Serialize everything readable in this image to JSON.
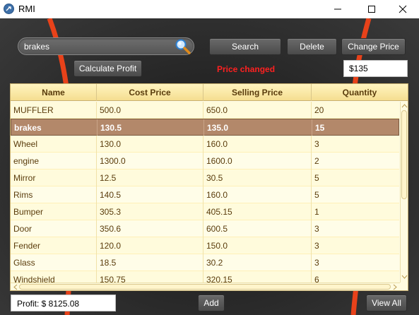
{
  "window": {
    "title": "RMI",
    "icon": "app-logo-icon",
    "controls": [
      "minimize-icon",
      "maximize-icon",
      "close-icon"
    ]
  },
  "search": {
    "value": "brakes",
    "icon": "magnifier-icon"
  },
  "toolbar": {
    "search_label": "Search",
    "delete_label": "Delete",
    "change_price_label": "Change Price",
    "calculate_profit_label": "Calculate Profit"
  },
  "status": {
    "message": "Price changed",
    "color": "#ff2020"
  },
  "price_input": {
    "value": "$135"
  },
  "table": {
    "columns": [
      "Name",
      "Cost Price",
      "Selling Price",
      "Quantity"
    ],
    "rows": [
      {
        "name": "MUFFLER",
        "cost": "500.0",
        "selling": "650.0",
        "quantity": "20"
      },
      {
        "name": "brakes",
        "cost": "130.5",
        "selling": "135.0",
        "quantity": "15"
      },
      {
        "name": "Wheel",
        "cost": "130.0",
        "selling": "160.0",
        "quantity": "3"
      },
      {
        "name": "engine",
        "cost": "1300.0",
        "selling": "1600.0",
        "quantity": "2"
      },
      {
        "name": "Mirror",
        "cost": "12.5",
        "selling": "30.5",
        "quantity": "5"
      },
      {
        "name": "Rims",
        "cost": "140.5",
        "selling": "160.0",
        "quantity": "5"
      },
      {
        "name": "Bumper",
        "cost": "305.3",
        "selling": "405.15",
        "quantity": "1"
      },
      {
        "name": "Door",
        "cost": "350.6",
        "selling": "600.5",
        "quantity": "3"
      },
      {
        "name": "Fender",
        "cost": "120.0",
        "selling": "150.0",
        "quantity": "3"
      },
      {
        "name": "Glass",
        "cost": "18.5",
        "selling": "30.2",
        "quantity": "3"
      },
      {
        "name": "Windshield",
        "cost": "150.75",
        "selling": "320.15",
        "quantity": "6"
      }
    ],
    "selected_row": 1,
    "header_color": "#5a3c0c",
    "selected_color": "#b3886a"
  },
  "footer": {
    "profit_text": "Profit: $ 8125.08",
    "add_label": "Add",
    "view_all_label": "View All"
  },
  "colors": {
    "accent_stripe": "#e8421a",
    "row_background": "#fffbdc"
  }
}
